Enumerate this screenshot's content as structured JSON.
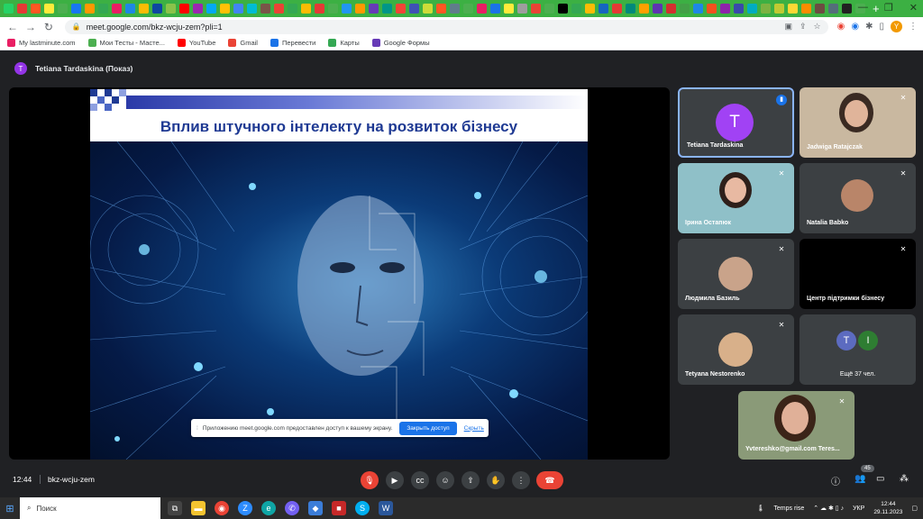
{
  "browser": {
    "tab_colors": [
      "#25d366",
      "#e53935",
      "#ff5722",
      "#ffeb3b",
      "#4caf50",
      "#1877f2",
      "#ff9800",
      "#34a853",
      "#e91e63",
      "#1e88e5",
      "#fbbc05",
      "#0d47a1",
      "#8bc34a",
      "#ff0000",
      "#9c27b0",
      "#03a9f4",
      "#ffc107",
      "#4285f4",
      "#00bcd4",
      "#795548",
      "#ea4335",
      "#34a853",
      "#fbbc05",
      "#e53935",
      "#4caf50",
      "#2196f3",
      "#ff9800",
      "#673ab7",
      "#009688",
      "#f44336",
      "#3f51b5",
      "#cddc39",
      "#ff5722",
      "#607d8b",
      "#4caf50",
      "#e91e63",
      "#1a73e8",
      "#ffeb3b",
      "#9e9e9e",
      "#ea4335",
      "#4caf50",
      "#000000",
      "#34a853",
      "#fbbc05",
      "#1565c0",
      "#e53935",
      "#00897b",
      "#ffa000",
      "#5e35b1",
      "#d32f2f",
      "#43a047",
      "#1e88e5",
      "#f4511e",
      "#8e24aa",
      "#3949ab",
      "#00acc1",
      "#7cb342",
      "#c0ca33",
      "#fdd835",
      "#fb8c00",
      "#6d4c41",
      "#546e7a",
      "#212121",
      "#4caf50"
    ],
    "new_tab": "+",
    "url": "meet.google.com/bkz-wcju-zem?pli=1",
    "profile_initial": "Y",
    "bookmarks": [
      {
        "label": "My lastminute.com",
        "color": "#e91e63"
      },
      {
        "label": "Мои Тесты - Масте...",
        "color": "#4caf50"
      },
      {
        "label": "YouTube",
        "color": "#ff0000"
      },
      {
        "label": "Gmail",
        "color": "#ea4335"
      },
      {
        "label": "Перевести",
        "color": "#1a73e8"
      },
      {
        "label": "Карты",
        "color": "#34a853"
      },
      {
        "label": "Google Формы",
        "color": "#673ab7"
      }
    ]
  },
  "meet": {
    "presenter_initial": "T",
    "presenter_label": "Tetiana Tardaskina (Показ)",
    "slide_title": "Вплив штучного інтелекту на розвиток бізнесу",
    "share_notice": "Приложению meet.google.com предоставлен доступ к вашему экрану.",
    "share_stop": "Закрыть доступ",
    "share_hide": "Скрыть",
    "participants": [
      {
        "name": "Tetiana Tardaskina",
        "initial": "T"
      },
      {
        "name": "Jadwiga Ratajczak"
      },
      {
        "name": "Ірина Остапюк"
      },
      {
        "name": "Natalia Babko"
      },
      {
        "name": "Людмила Базиль"
      },
      {
        "name": "Центр підтримки бізнесу"
      },
      {
        "name": "Tetyana Nestorenko"
      },
      {
        "more_label": "Ещё 37 чел.",
        "initials": [
          "T",
          "I"
        ]
      },
      {
        "name": "Yvtereshko@gmail.com Teres..."
      }
    ],
    "time": "12:44",
    "code": "bkz-wcju-zem",
    "people_count": "45"
  },
  "taskbar": {
    "search_placeholder": "Поиск",
    "weather": "Temps rise",
    "lang": "УКР",
    "time": "12:44",
    "date": "29.11.2023"
  }
}
